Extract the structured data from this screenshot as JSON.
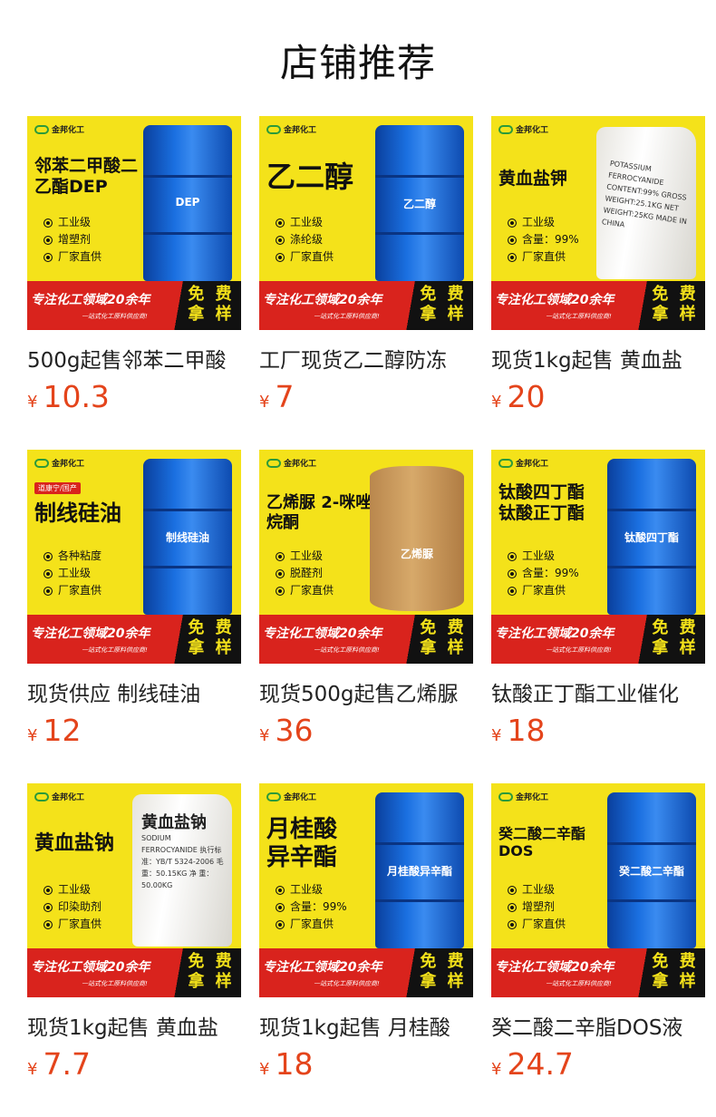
{
  "header": {
    "title": "店铺推荐"
  },
  "theme": {
    "price_color": "#e4441b",
    "poster_yellow": "#f4e21a",
    "drum_blue": "#1a6fe0",
    "banner_red": "#d9231d"
  },
  "poster_common": {
    "logo_text": "金邦化工",
    "banner_main": "专注化工领域20余年",
    "banner_sub": "一站式化工原料供应商!",
    "free_line1": "免 费",
    "free_line2": "拿 样"
  },
  "products": [
    {
      "title": "500g起售邻苯二甲酸",
      "currency": "¥",
      "price": "10.3",
      "poster": {
        "kind": "drum",
        "headline": "邻苯二甲酸二乙酯DEP",
        "product_label": "DEP",
        "bullets": [
          "工业级",
          "增塑剂",
          "厂家直供"
        ]
      }
    },
    {
      "title": "工厂现货乙二醇防冻",
      "currency": "¥",
      "price": "7",
      "poster": {
        "kind": "drum",
        "headline": "乙二醇",
        "product_label": "乙二醇",
        "bullets": [
          "工业级",
          "涤纶级",
          "厂家直供"
        ]
      }
    },
    {
      "title": "现货1kg起售 黄血盐",
      "currency": "¥",
      "price": "20",
      "poster": {
        "kind": "sack",
        "headline": "黄血盐钾",
        "sack_text": "POTASSIUM FERROCYANIDE CONTENT:99% GROSS WEIGHT:25.1KG NET WEIGHT:25KG MADE IN CHINA",
        "bullets": [
          "工业级",
          "含量：99%",
          "厂家直供"
        ]
      }
    },
    {
      "title": "现货供应 制线硅油",
      "currency": "¥",
      "price": "12",
      "poster": {
        "kind": "drum",
        "tag": "道康宁/国产",
        "headline": "制线硅油",
        "product_label": "制线硅油",
        "bullets": [
          "各种粘度",
          "工业级",
          "厂家直供"
        ]
      }
    },
    {
      "title": "现货500g起售乙烯脲",
      "currency": "¥",
      "price": "36",
      "poster": {
        "kind": "carton",
        "headline": "乙烯脲 2-咪唑烷酮",
        "product_label": "乙烯脲",
        "bullets": [
          "工业级",
          "脱醛剂",
          "厂家直供"
        ]
      }
    },
    {
      "title": "钛酸正丁酯工业催化",
      "currency": "¥",
      "price": "18",
      "poster": {
        "kind": "drum",
        "headline": "钛酸四丁酯 钛酸正丁酯",
        "product_label": "钛酸四丁酯",
        "bullets": [
          "工业级",
          "含量：99%",
          "厂家直供"
        ]
      }
    },
    {
      "title": "现货1kg起售 黄血盐",
      "currency": "¥",
      "price": "7.7",
      "poster": {
        "kind": "sack",
        "headline": "黄血盐钠",
        "sack_title": "黄血盐钠",
        "sack_text": "SODIUM FERROCYANIDE 执行标准：YB/T 5324-2006 毛 重：50.15KG 净 重：50.00KG",
        "bullets": [
          "工业级",
          "印染助剂",
          "厂家直供"
        ]
      }
    },
    {
      "title": "现货1kg起售 月桂酸",
      "currency": "¥",
      "price": "18",
      "poster": {
        "kind": "drum",
        "headline": "月桂酸异辛酯",
        "product_label": "月桂酸异辛酯",
        "bullets": [
          "工业级",
          "含量：99%",
          "厂家直供"
        ]
      }
    },
    {
      "title": "癸二酸二辛脂DOS液",
      "currency": "¥",
      "price": "24.7",
      "poster": {
        "kind": "drum",
        "headline": "癸二酸二辛酯 DOS",
        "product_label": "癸二酸二辛酯",
        "bullets": [
          "工业级",
          "增塑剂",
          "厂家直供"
        ]
      }
    }
  ]
}
